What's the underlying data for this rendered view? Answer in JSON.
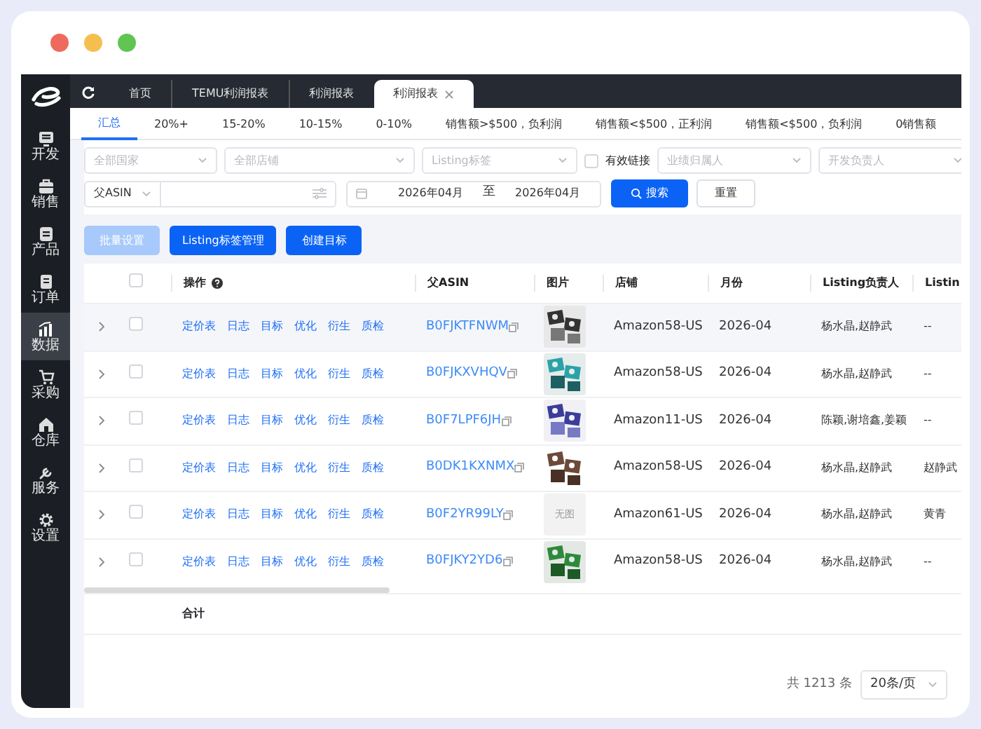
{
  "sidebar": {
    "items": [
      {
        "label": "开发",
        "selected": false
      },
      {
        "label": "销售",
        "selected": false
      },
      {
        "label": "产品",
        "selected": false
      },
      {
        "label": "订单",
        "selected": false
      },
      {
        "label": "数据",
        "selected": true
      },
      {
        "label": "采购",
        "selected": false
      },
      {
        "label": "仓库",
        "selected": false
      },
      {
        "label": "服务",
        "selected": false
      },
      {
        "label": "设置",
        "selected": false
      }
    ]
  },
  "page_tabs": [
    {
      "label": "首页",
      "selected": false,
      "closable": false
    },
    {
      "label": "TEMU利润报表",
      "selected": false,
      "closable": false
    },
    {
      "label": "利润报表",
      "selected": false,
      "closable": false
    },
    {
      "label": "利润报表",
      "selected": true,
      "closable": true
    }
  ],
  "sub_tabs": [
    {
      "label": "汇总",
      "selected": true
    },
    {
      "label": "20%+",
      "selected": false
    },
    {
      "label": "15-20%",
      "selected": false
    },
    {
      "label": "10-15%",
      "selected": false
    },
    {
      "label": "0-10%",
      "selected": false
    },
    {
      "label": "销售额>$500，负利润",
      "selected": false
    },
    {
      "label": "销售额<$500，正利润",
      "selected": false
    },
    {
      "label": "销售额<$500，负利润",
      "selected": false
    },
    {
      "label": "0销售额",
      "selected": false
    }
  ],
  "filters": {
    "country": {
      "placeholder": "全部国家"
    },
    "shop": {
      "placeholder": "全部店铺"
    },
    "tag": {
      "placeholder": "Listing标签"
    },
    "valid_link": {
      "label": "有效链接",
      "checked": false
    },
    "owner": {
      "placeholder": "业绩归属人"
    },
    "developer": {
      "placeholder": "开发负责人"
    },
    "asin_type": {
      "value": "父ASIN"
    },
    "date_from": "2026年04月",
    "date_sep": "至",
    "date_to": "2026年04月",
    "search_button": "搜索",
    "reset_button": "重置"
  },
  "toolbar": [
    {
      "label": "批量设置",
      "disabled": true
    },
    {
      "label": "Listing标签管理",
      "disabled": false
    },
    {
      "label": "创建目标",
      "disabled": false
    }
  ],
  "table": {
    "columns": [
      "操作",
      "父ASIN",
      "图片",
      "店铺",
      "月份",
      "Listing负责人",
      "Listin"
    ],
    "header_checked": false,
    "rows": [
      {
        "checked": false,
        "actions": [
          "定价表",
          "日志",
          "目标",
          "优化",
          "衍生",
          "质检"
        ],
        "asin": "B0FJKTFNWM",
        "image": {
          "kind": "picture"
        },
        "shop": "Amazon58-US",
        "month": "2026-04",
        "owner": "杨水晶,赵静武",
        "column_9": "--"
      },
      {
        "checked": false,
        "actions": [
          "定价表",
          "日志",
          "目标",
          "优化",
          "衍生",
          "质检"
        ],
        "asin": "B0FJKXVHQV",
        "image": {
          "kind": "picture"
        },
        "shop": "Amazon58-US",
        "month": "2026-04",
        "owner": "杨水晶,赵静武",
        "column_9": "--"
      },
      {
        "checked": false,
        "actions": [
          "定价表",
          "日志",
          "目标",
          "优化",
          "衍生",
          "质检"
        ],
        "asin": "B0F7LPF6JH",
        "image": {
          "kind": "picture"
        },
        "shop": "Amazon11-US",
        "month": "2026-04",
        "owner": "陈颖,谢培鑫,姜颖",
        "column_9": "--"
      },
      {
        "checked": false,
        "actions": [
          "定价表",
          "日志",
          "目标",
          "优化",
          "衍生",
          "质检"
        ],
        "asin": "B0DK1KXNMX",
        "image": {
          "kind": "picture"
        },
        "shop": "Amazon58-US",
        "month": "2026-04",
        "owner": "杨水晶,赵静武",
        "column_9": "赵静武"
      },
      {
        "checked": false,
        "actions": [
          "定价表",
          "日志",
          "目标",
          "优化",
          "衍生",
          "质检"
        ],
        "asin": "B0F2YR99LY",
        "image": {
          "kind": "none",
          "text": "无图"
        },
        "shop": "Amazon61-US",
        "month": "2026-04",
        "owner": "杨水晶,赵静武",
        "column_9": "黄青"
      },
      {
        "checked": false,
        "actions": [
          "定价表",
          "日志",
          "目标",
          "优化",
          "衍生",
          "质检"
        ],
        "asin": "B0FJKY2YD6",
        "image": {
          "kind": "picture"
        },
        "shop": "Amazon58-US",
        "month": "2026-04",
        "owner": "杨水晶,赵静武",
        "column_9": "--"
      }
    ],
    "total_label": "合计"
  },
  "pagination": {
    "total": "共 1213 条",
    "page_size": "20条/页"
  }
}
